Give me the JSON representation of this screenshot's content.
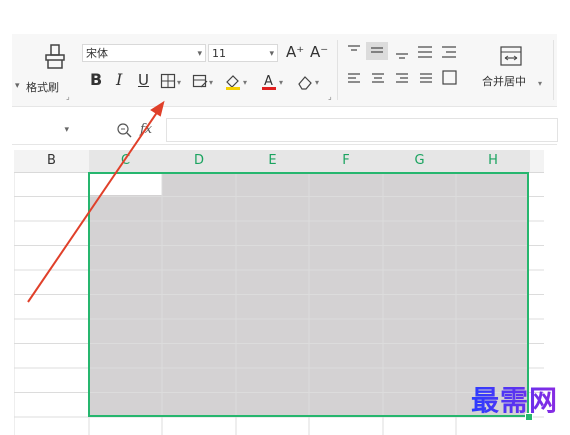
{
  "ribbon": {
    "format_painter_label": "格式刷",
    "font_name": "宋体",
    "font_size": "11",
    "grow_font": "A⁺",
    "shrink_font": "A⁻",
    "bold": "B",
    "italic": "I",
    "underline": "U",
    "merge_center_label": "合并居中",
    "caret": "▾"
  },
  "formula_bar": {
    "name_box_value": "",
    "fx_label": "fx",
    "formula_value": ""
  },
  "columns": [
    {
      "label": "B",
      "selected": false
    },
    {
      "label": "C",
      "selected": true
    },
    {
      "label": "D",
      "selected": true
    },
    {
      "label": "E",
      "selected": true
    },
    {
      "label": "F",
      "selected": true
    },
    {
      "label": "G",
      "selected": true
    },
    {
      "label": "H",
      "selected": true
    }
  ],
  "colors": {
    "selection_border": "#26b66e",
    "selection_fill": "#d4d2d3",
    "header_selected_text": "#1aa35f",
    "annotation_arrow": "#e0402a",
    "watermark_start": "#2a3cff",
    "watermark_end": "#8a2be2",
    "font_color_swatch": "#e02020",
    "fill_color_swatch": "#f5d000"
  },
  "watermark": "最需网",
  "icons": [
    "format-painter-icon",
    "border-icon",
    "fill-color-icon",
    "font-color-icon",
    "clear-format-icon",
    "align-icon",
    "indent-icon",
    "merge-center-icon",
    "zoom-icon"
  ]
}
